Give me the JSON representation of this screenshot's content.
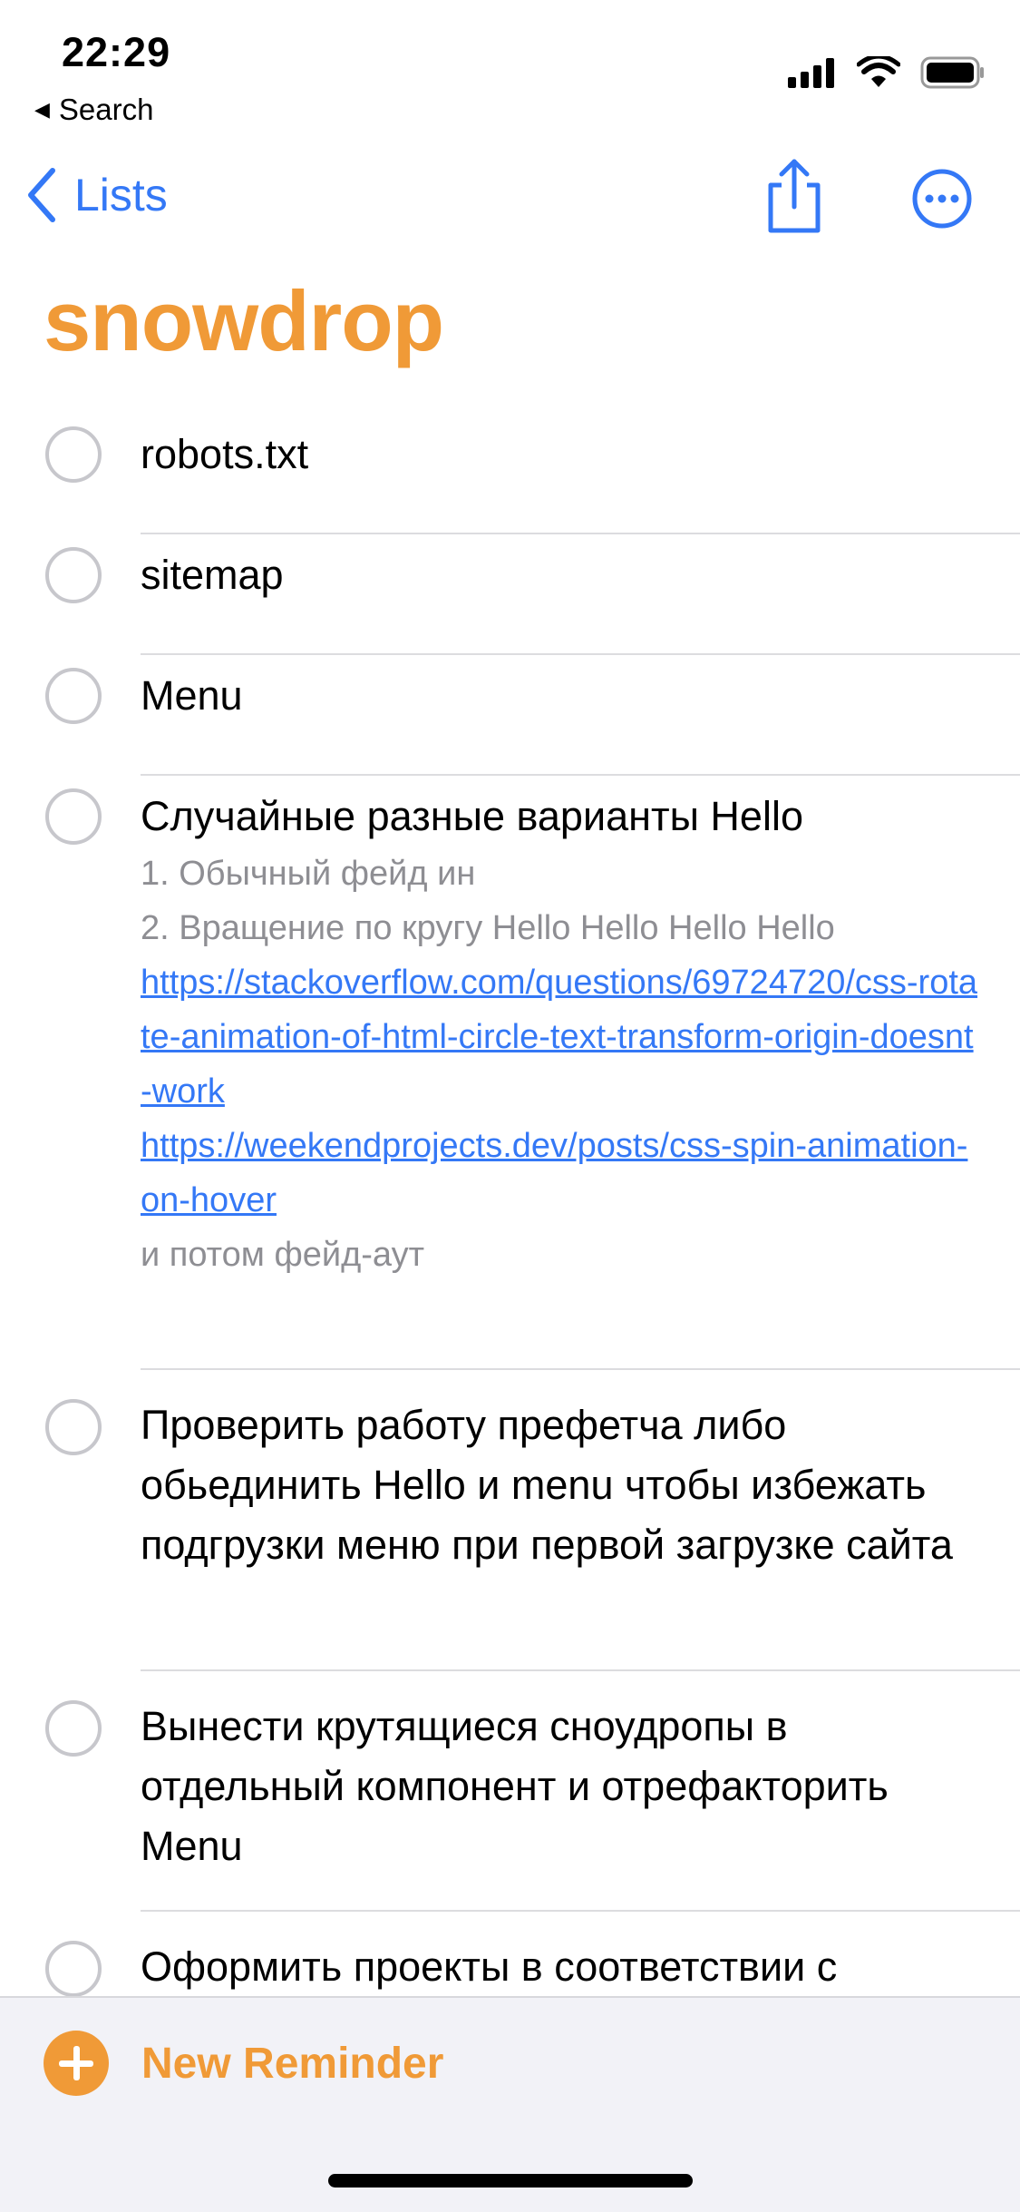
{
  "status_bar": {
    "time": "22:29",
    "back_app": "Search"
  },
  "nav": {
    "back_label": "Lists"
  },
  "list": {
    "title": "snowdrop",
    "accent_color": "#f09a37"
  },
  "items": [
    {
      "title": "robots.txt"
    },
    {
      "title": "sitemap"
    },
    {
      "title": "Menu"
    },
    {
      "title": "Случайные разные варианты Hello",
      "notes": {
        "line1": "1. Обычный фейд ин",
        "line2": "2. Вращение по кругу Hello Hello Hello Hello",
        "link1": "https://stackoverflow.com/questions/69724720/css-rotate-animation-of-html-circle-text-transform-origin-doesnt-work",
        "link2": "https://weekendprojects.dev/posts/css-spin-animation-on-hover",
        "line3": "и потом фейд-аут"
      }
    },
    {
      "title": "Проверить работу префетча либо обьединить Hello и menu чтобы избежать подгрузки меню при первой загрузке сайта"
    },
    {
      "title": "Вынести крутящиеся сноудропы в отдельный компонент и отрефакторить Menu"
    },
    {
      "title": "Оформить проекты в соответствии с"
    }
  ],
  "bottom": {
    "new_reminder_label": "New Reminder"
  },
  "icons": {
    "back": "chevron-left-icon",
    "share": "share-icon",
    "more": "ellipsis-circle-icon",
    "signal": "cellular-signal-icon",
    "wifi": "wifi-icon",
    "battery": "battery-icon",
    "add": "plus-circle-icon"
  },
  "colors": {
    "link": "#3478f6",
    "accent": "#f09a37",
    "notes": "#8e8e93"
  }
}
